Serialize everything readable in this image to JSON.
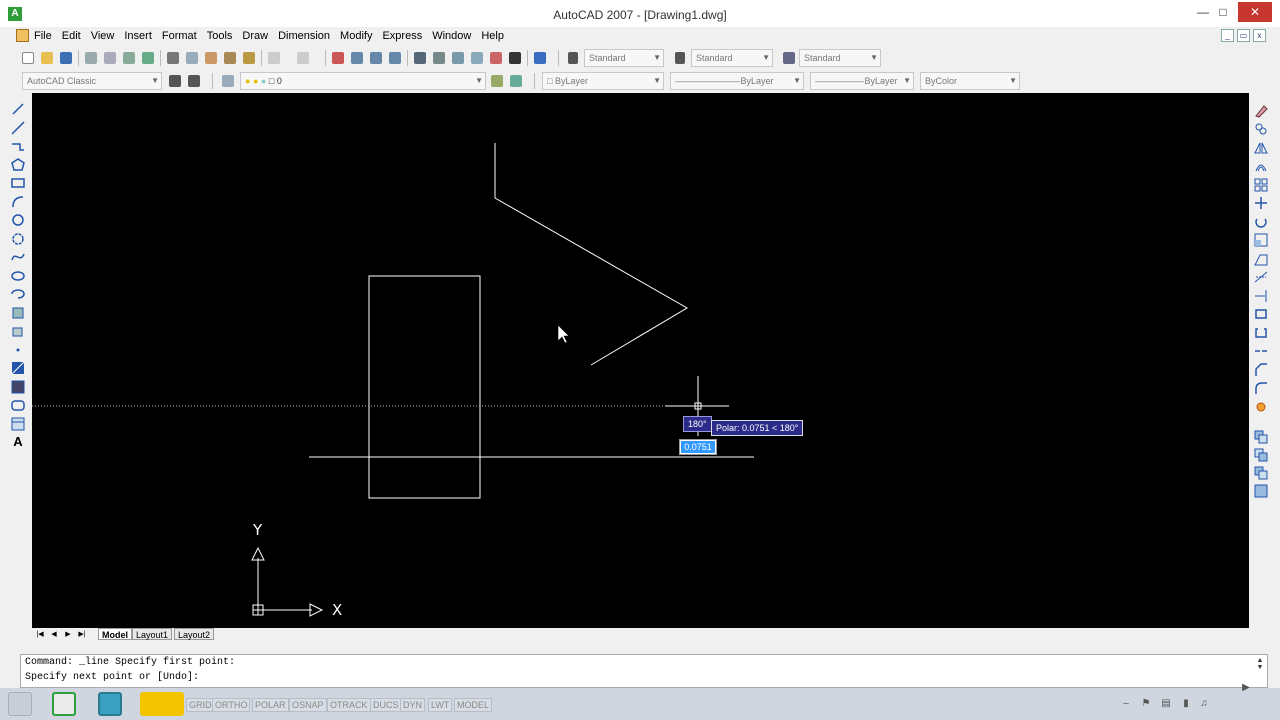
{
  "window": {
    "title": "AutoCAD 2007 - [Drawing1.dwg]",
    "app_icon_glyph": "A"
  },
  "menu": {
    "items": [
      "File",
      "Edit",
      "View",
      "Insert",
      "Format",
      "Tools",
      "Draw",
      "Dimension",
      "Modify",
      "Express",
      "Window",
      "Help"
    ]
  },
  "toolbar_styles": {
    "text_style": "Standard",
    "dim_style": "Standard",
    "table_style": "Standard"
  },
  "toolbar_layers": {
    "workspace": "AutoCAD Classic",
    "layer": "0",
    "color": "ByLayer",
    "linetype": "ByLayer",
    "lineweight": "ByLayer",
    "plotstyle": "ByColor"
  },
  "canvas": {
    "ucs_x_label": "X",
    "ucs_y_label": "Y",
    "polar_angle": "180°",
    "polar_tooltip": "Polar: 0.0751 < 180°",
    "dyn_input_value": "0.0751"
  },
  "layout_tabs": [
    "Model",
    "Layout1",
    "Layout2"
  ],
  "command_lines": [
    "Command: _line Specify first point:",
    "Specify next point or [Undo]:"
  ],
  "status_buttons": [
    "GRID",
    "ORTHO",
    "POLAR",
    "OSNAP",
    "OTRACK",
    "DUCS",
    "DYN",
    "LWT",
    "MODEL"
  ],
  "colors": {
    "canvas_bg": "#000000",
    "geometry": "#ffffff",
    "tooltip_bg": "#2b2b8a",
    "close_btn": "#c7362f"
  }
}
